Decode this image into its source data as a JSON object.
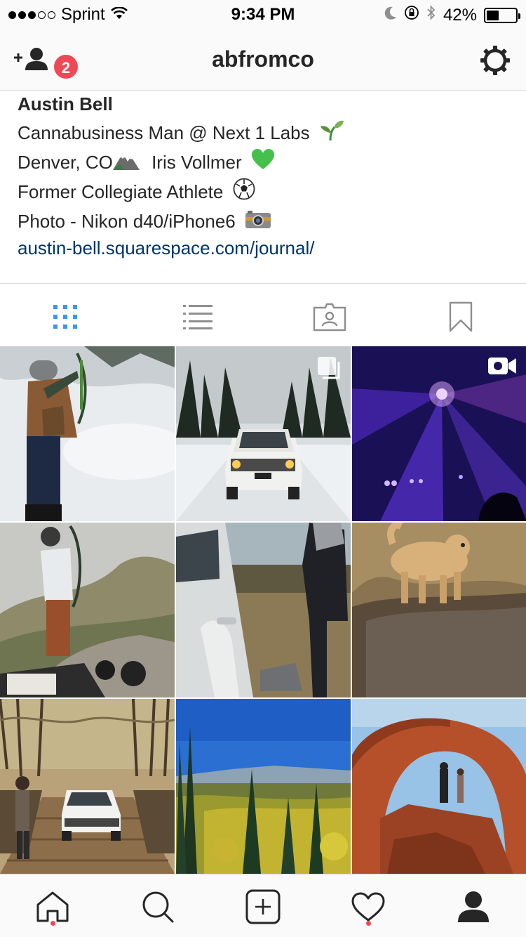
{
  "status_bar": {
    "carrier": "Sprint",
    "time": "9:34 PM",
    "battery": "42%",
    "battery_level": 0.42
  },
  "header": {
    "username": "abfromco",
    "notification_count": "2"
  },
  "bio": {
    "name": "Austin Bell",
    "lines": [
      "Cannabusiness Man @ Next 1 Labs",
      "Denver, CO",
      "Iris Vollmer",
      "Former Collegiate Athlete",
      "Photo - Nikon d40/iPhone6"
    ],
    "link": "austin-bell.squarespace.com/journal/"
  },
  "tabs": [
    "grid-view",
    "list-view",
    "tagged-photos",
    "saved"
  ],
  "active_tab": "grid-view",
  "grid": {
    "photos": [
      {
        "subject": "archer in snow",
        "type": "photo"
      },
      {
        "subject": "white SUV on snowy road",
        "type": "multiple"
      },
      {
        "subject": "purple concert lights",
        "type": "video"
      },
      {
        "subject": "archer on gravel road",
        "type": "photo"
      },
      {
        "subject": "SUV and person in field",
        "type": "photo"
      },
      {
        "subject": "golden retriever in creek",
        "type": "photo"
      },
      {
        "subject": "SUV on wooden bridge",
        "type": "photo"
      },
      {
        "subject": "aspen valley vista",
        "type": "photo"
      },
      {
        "subject": "red rock arch",
        "type": "photo"
      }
    ]
  },
  "bottom_nav": [
    "home",
    "search",
    "new-post",
    "activity",
    "profile"
  ],
  "colors": {
    "accent_blue": "#3897f0",
    "badge_red": "#ed4956",
    "link_blue": "#003569"
  }
}
